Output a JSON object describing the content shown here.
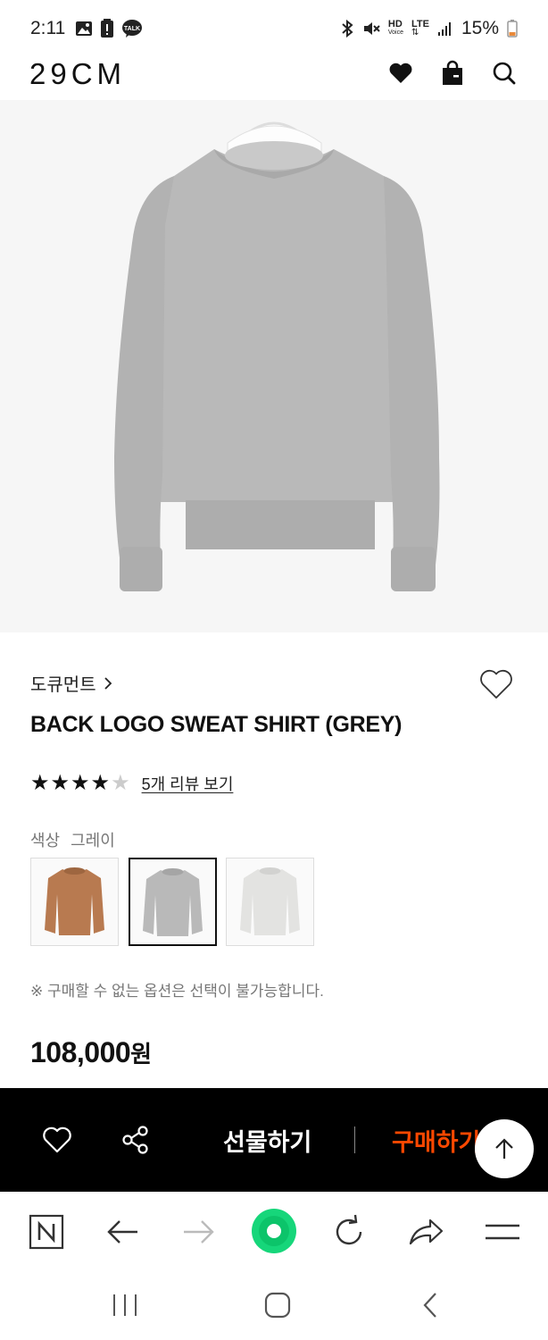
{
  "status_bar": {
    "time": "2:11",
    "battery": "15%",
    "hd_label": "HD",
    "voice_label": "Voice",
    "lte_label": "LTE",
    "talk_label": "TALK"
  },
  "header": {
    "logo": "29CM"
  },
  "product": {
    "brand": "도큐먼트",
    "title": "BACK LOGO SWEAT SHIRT (GREY)",
    "rating_stars": 4,
    "rating_max": 5,
    "review_link": "5개 리뷰 보기",
    "color_label": "색상",
    "color_value": "그레이",
    "swatches": [
      {
        "name": "brown",
        "color": "#b87a50",
        "selected": false
      },
      {
        "name": "grey",
        "color": "#b9b9b9",
        "selected": true
      },
      {
        "name": "light-grey",
        "color": "#e3e3e1",
        "selected": false
      }
    ],
    "notice": "※ 구매할 수 없는 옵션은 선택이 불가능합니다.",
    "price": "108,000",
    "price_unit": "원"
  },
  "buy_bar": {
    "gift_label": "선물하기",
    "purchase_label": "구매하기"
  },
  "colors": {
    "purchase_accent": "#ff4800",
    "browser_green": "#16d67a",
    "bar_bg": "#000000"
  }
}
